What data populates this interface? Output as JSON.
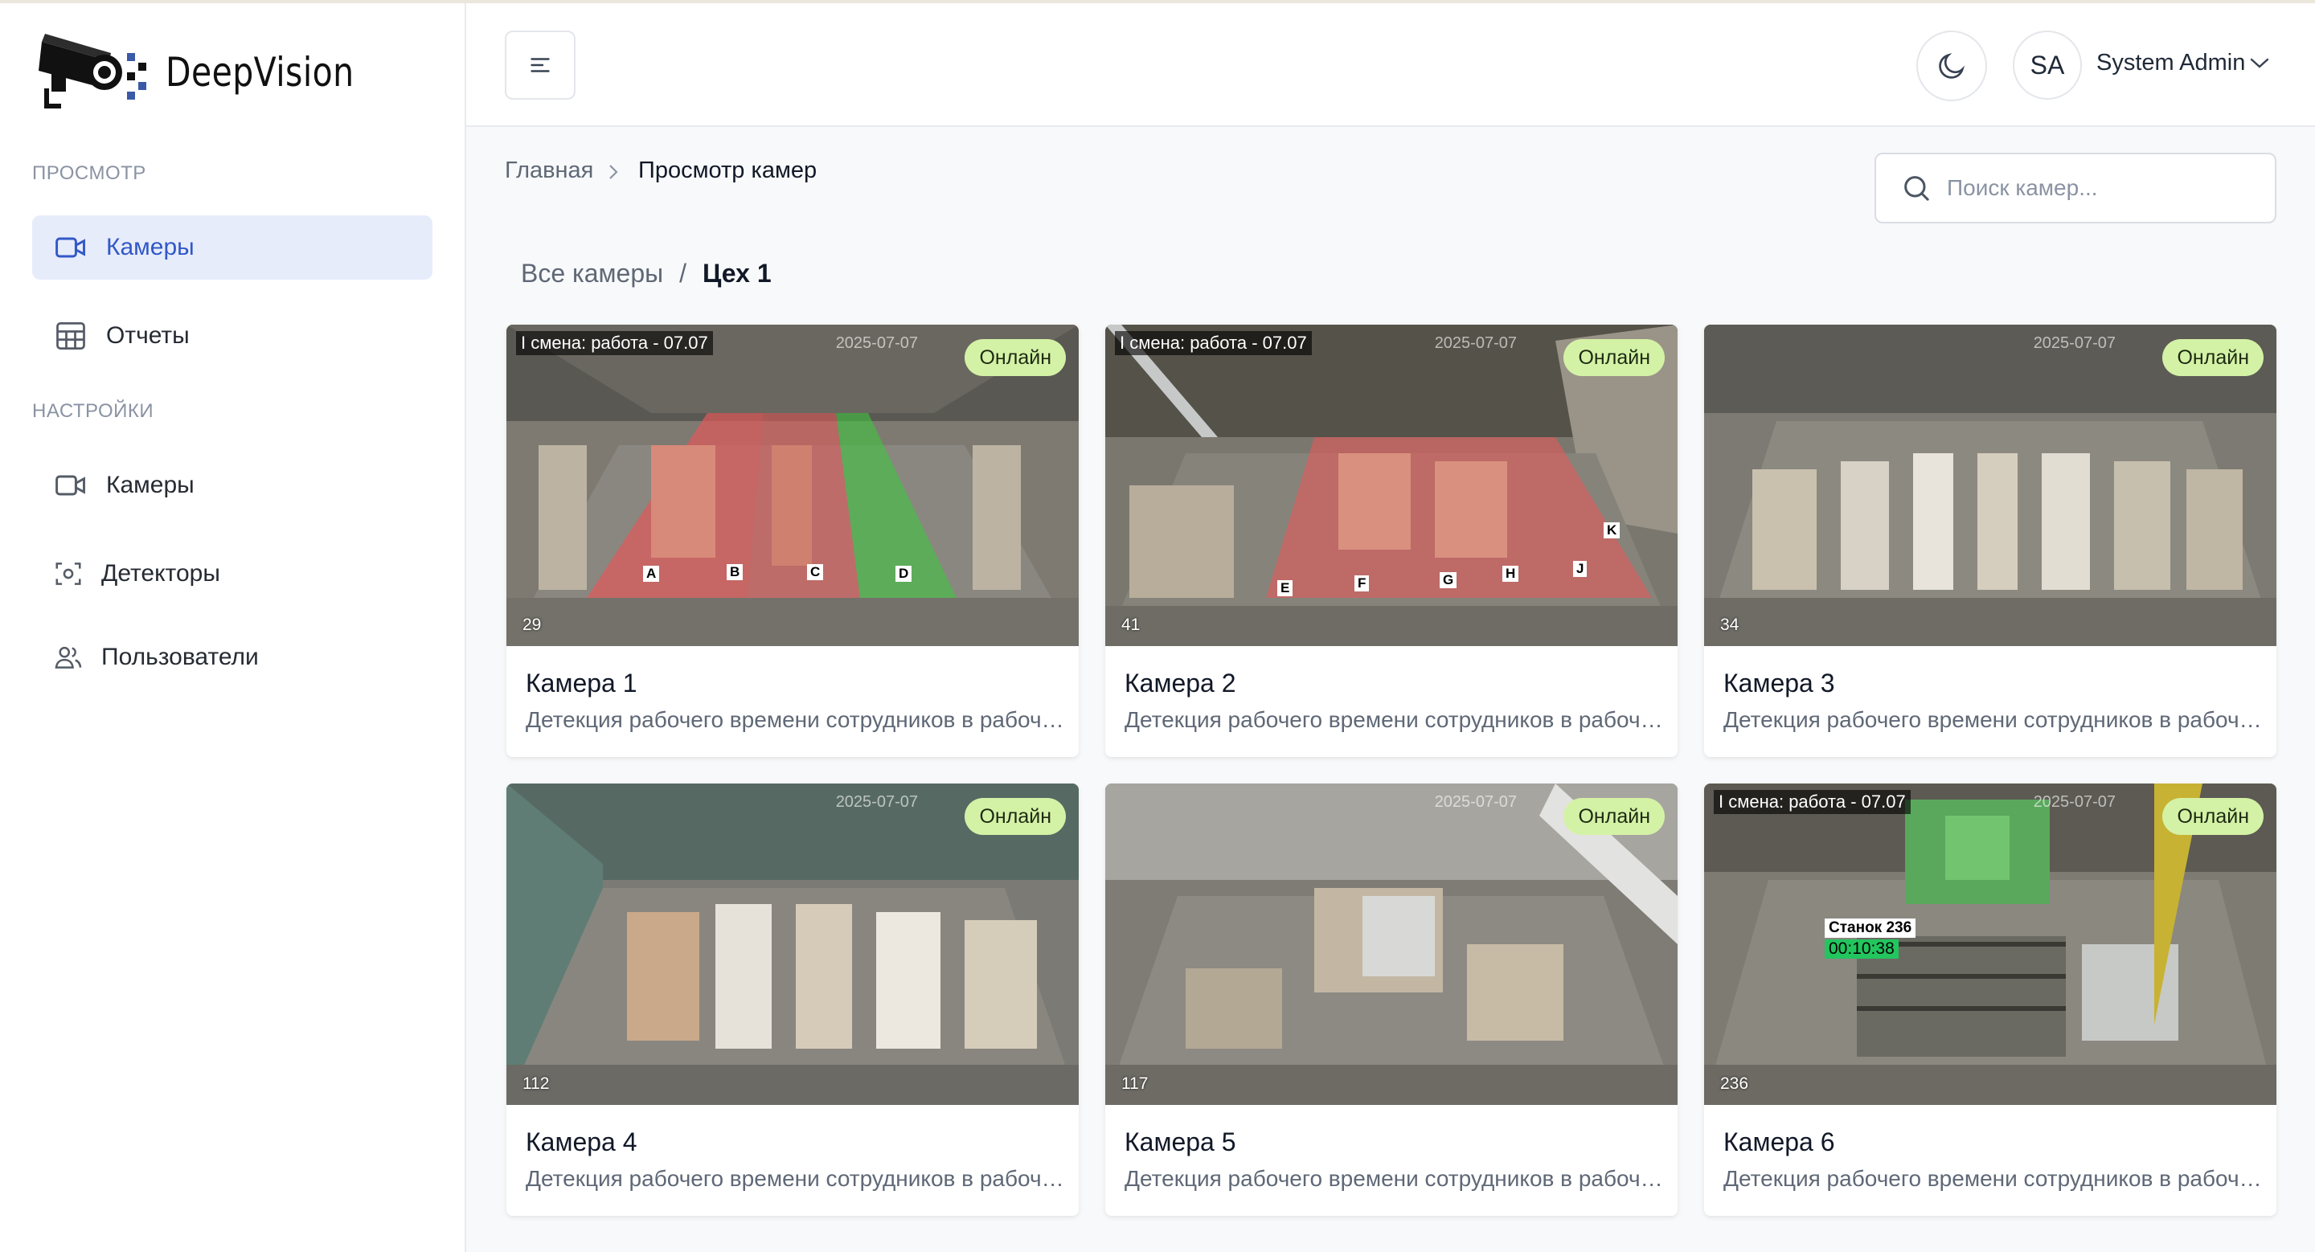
{
  "app": {
    "name": "DeepVision"
  },
  "sidebar": {
    "sections": [
      {
        "label": "ПРОСМОТР",
        "items": [
          {
            "label": "Камеры",
            "icon": "video-camera-icon",
            "active": true
          },
          {
            "label": "Отчеты",
            "icon": "table-icon",
            "active": false
          }
        ]
      },
      {
        "label": "НАСТРОЙКИ",
        "items": [
          {
            "label": "Камеры",
            "icon": "video-camera-icon",
            "active": false
          },
          {
            "label": "Детекторы",
            "icon": "scan-icon",
            "active": false
          },
          {
            "label": "Пользователи",
            "icon": "users-icon",
            "active": false
          }
        ]
      }
    ]
  },
  "header": {
    "menu_icon": "menu-icon",
    "theme_icon": "moon-icon",
    "user": {
      "initials": "SA",
      "name": "System Admin"
    }
  },
  "breadcrumb": {
    "home": "Главная",
    "current": "Просмотр камер"
  },
  "search": {
    "placeholder": "Поиск камер..."
  },
  "group": {
    "parent": "Все камеры",
    "separator": "/",
    "current": "Цех 1"
  },
  "cameras": [
    {
      "title": "Камера 1",
      "description": "Детекция рабочего времени сотрудников в рабочей зоне",
      "status": "Онлайн",
      "overlay_title": "I смена: работа - 07.07",
      "overlay_date": "2025-07-07",
      "id_label": "29"
    },
    {
      "title": "Камера 2",
      "description": "Детекция рабочего времени сотрудников в рабочей зоне",
      "status": "Онлайн",
      "overlay_title": "I смена: работа - 07.07",
      "overlay_date": "2025-07-07",
      "id_label": "41"
    },
    {
      "title": "Камера 3",
      "description": "Детекция рабочего времени сотрудников в рабочей зоне",
      "status": "Онлайн",
      "overlay_title": "",
      "overlay_date": "2025-07-07",
      "id_label": "34"
    },
    {
      "title": "Камера 4",
      "description": "Детекция рабочего времени сотрудников в рабочей зоне",
      "status": "Онлайн",
      "overlay_title": "",
      "overlay_date": "2025-07-07",
      "id_label": "112"
    },
    {
      "title": "Камера 5",
      "description": "Детекция рабочего времени сотрудников в рабочей зоне",
      "status": "Онлайн",
      "overlay_title": "",
      "overlay_date": "2025-07-07",
      "id_label": "117"
    },
    {
      "title": "Камера 6",
      "description": "Детекция рабочего времени сотрудников в рабочей зоне",
      "status": "Онлайн",
      "overlay_title": "I смена: работа - 07.07",
      "overlay_date": "2025-07-07",
      "id_label": "236",
      "machine": {
        "name": "Станок 236",
        "timer": "00:10:38"
      }
    }
  ],
  "zones_cam1": [
    "A",
    "B",
    "C",
    "D"
  ],
  "zones_cam2": [
    "E",
    "F",
    "G",
    "H",
    "J",
    "K"
  ],
  "colors": {
    "accent": "#3258c7",
    "active_bg": "#e7ecfb",
    "online_badge": "#d4f2a6",
    "zone_red": "#e05a5a",
    "zone_green": "#3fc43f"
  }
}
